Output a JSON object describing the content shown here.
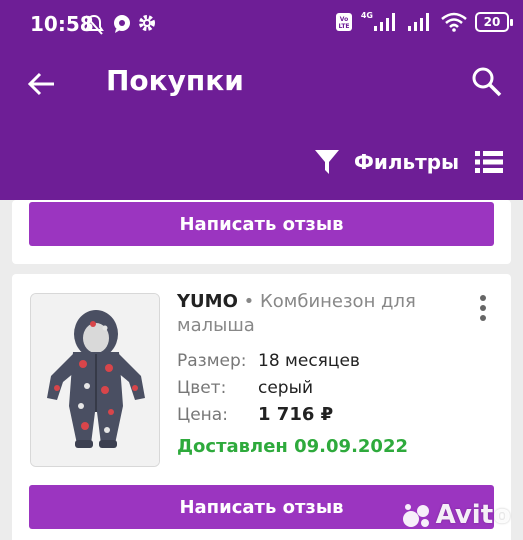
{
  "status_bar": {
    "time": "10:58",
    "network": "4G",
    "battery": "20",
    "icons": [
      "mute-icon",
      "chat-bubble-icon",
      "gear-icon",
      "volte-icon",
      "signal-icon",
      "wifi-icon",
      "battery-icon"
    ]
  },
  "app_bar": {
    "title": "Покупки",
    "filter_label": "Фильтры",
    "icons": [
      "back-arrow-icon",
      "search-icon",
      "filter-funnel-icon",
      "list-view-icon"
    ]
  },
  "colors": {
    "primary": "#6e1e96",
    "button": "#9b35c0",
    "delivered": "#2eaa3c"
  },
  "cards": [
    {
      "review_button": "Написать отзыв"
    },
    {
      "brand": "YUMO",
      "separator": "•",
      "product_name": "Комбинезон для малыша",
      "size_label": "Размер:",
      "size_value": "18 месяцев",
      "color_label": "Цвет:",
      "color_value": "серый",
      "price_label": "Цена:",
      "price_value": "1 716 ₽",
      "status": "Доставлен 09.09.2022",
      "review_button": "Написать отзыв"
    }
  ],
  "watermark": {
    "text": "Avito"
  }
}
